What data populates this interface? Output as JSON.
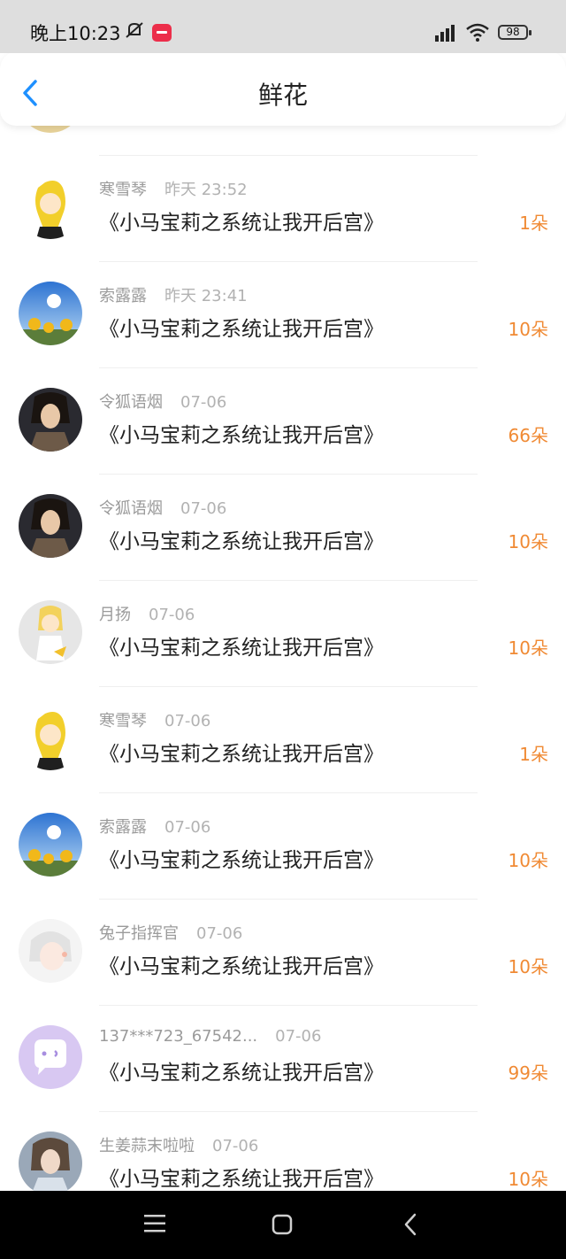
{
  "status": {
    "time": "晚上10:23",
    "battery": "98"
  },
  "header": {
    "title": "鲜花"
  },
  "rows": [
    {
      "user": "寒雪琴",
      "time": "昨天 23:52",
      "book": "《小马宝莉之系统让我开后宫》",
      "amount": "1朵"
    },
    {
      "user": "索露露",
      "time": "昨天 23:41",
      "book": "《小马宝莉之系统让我开后宫》",
      "amount": "10朵"
    },
    {
      "user": "令狐语烟",
      "time": "07-06",
      "book": "《小马宝莉之系统让我开后宫》",
      "amount": "66朵"
    },
    {
      "user": "令狐语烟",
      "time": "07-06",
      "book": "《小马宝莉之系统让我开后宫》",
      "amount": "10朵"
    },
    {
      "user": "月扬",
      "time": "07-06",
      "book": "《小马宝莉之系统让我开后宫》",
      "amount": "10朵"
    },
    {
      "user": "寒雪琴",
      "time": "07-06",
      "book": "《小马宝莉之系统让我开后宫》",
      "amount": "1朵"
    },
    {
      "user": "索露露",
      "time": "07-06",
      "book": "《小马宝莉之系统让我开后宫》",
      "amount": "10朵"
    },
    {
      "user": "兔子指挥官",
      "time": "07-06",
      "book": "《小马宝莉之系统让我开后宫》",
      "amount": "10朵"
    },
    {
      "user": "137***723_67542...",
      "time": "07-06",
      "book": "《小马宝莉之系统让我开后宫》",
      "amount": "99朵"
    },
    {
      "user": "生姜蒜末啦啦",
      "time": "07-06",
      "book": "《小马宝莉之系统让我开后宫》",
      "amount": "10朵"
    }
  ],
  "colors": {
    "accent": "#f08a34",
    "back": "#1e90ff"
  }
}
